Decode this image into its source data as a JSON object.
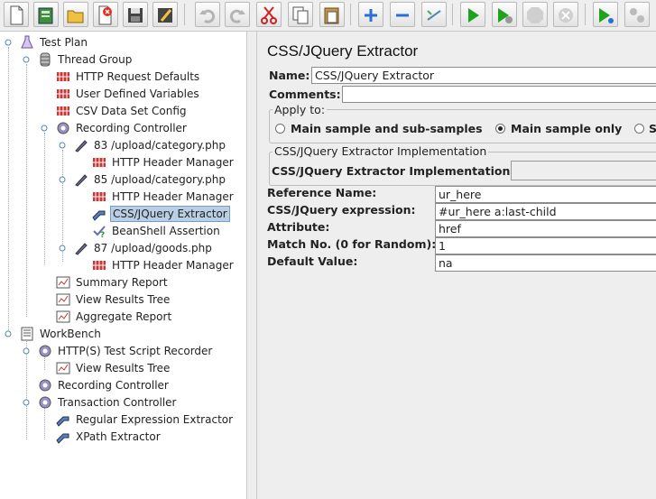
{
  "toolbar": {
    "buttons": [
      "new-icon",
      "templates-icon",
      "open-icon",
      "close-icon",
      "save-icon",
      "save-as-icon",
      "undo-icon",
      "redo-icon",
      "cut-icon",
      "copy-icon",
      "paste-icon",
      "expand-icon",
      "collapse-icon",
      "toggle-icon",
      "start-icon",
      "start-no-pauses-icon",
      "stop-icon",
      "shutdown-icon",
      "remote-start-icon",
      "remote-start-all-icon"
    ]
  },
  "tree": {
    "items": [
      {
        "label": "Test Plan",
        "icon": "test-plan-icon"
      },
      {
        "label": "Thread Group",
        "icon": "thread-group-icon"
      },
      {
        "label": "HTTP Request Defaults",
        "icon": "config-element-icon"
      },
      {
        "label": "User Defined Variables",
        "icon": "config-element-icon"
      },
      {
        "label": "CSV Data Set Config",
        "icon": "config-element-icon"
      },
      {
        "label": "Recording Controller",
        "icon": "controller-icon"
      },
      {
        "label": "83 /upload/category.php",
        "icon": "sampler-icon"
      },
      {
        "label": "HTTP Header Manager",
        "icon": "config-element-icon"
      },
      {
        "label": "85 /upload/category.php",
        "icon": "sampler-icon"
      },
      {
        "label": "HTTP Header Manager",
        "icon": "config-element-icon"
      },
      {
        "label": "CSS/JQuery Extractor",
        "icon": "extractor-icon"
      },
      {
        "label": "BeanShell Assertion",
        "icon": "assertion-icon"
      },
      {
        "label": "87 /upload/goods.php",
        "icon": "sampler-icon"
      },
      {
        "label": "HTTP Header Manager",
        "icon": "config-element-icon"
      },
      {
        "label": "Summary Report",
        "icon": "listener-icon"
      },
      {
        "label": "View Results Tree",
        "icon": "listener-icon"
      },
      {
        "label": "Aggregate Report",
        "icon": "listener-icon"
      },
      {
        "label": "WorkBench",
        "icon": "workbench-icon"
      },
      {
        "label": "HTTP(S) Test Script Recorder",
        "icon": "controller-icon"
      },
      {
        "label": "View Results Tree",
        "icon": "listener-icon"
      },
      {
        "label": "Recording Controller",
        "icon": "controller-icon"
      },
      {
        "label": "Transaction Controller",
        "icon": "controller-icon"
      },
      {
        "label": "Regular Expression Extractor",
        "icon": "extractor-icon"
      },
      {
        "label": "XPath Extractor",
        "icon": "extractor-icon"
      }
    ]
  },
  "panel": {
    "title": "CSS/JQuery Extractor",
    "name_label": "Name:",
    "name_value": "CSS/JQuery Extractor",
    "comments_label": "Comments:",
    "apply_to": {
      "title": "Apply to:",
      "options": [
        "Main sample and sub-samples",
        "Main sample only",
        "S"
      ],
      "selected": "Main sample only"
    },
    "impl": {
      "group_title": "CSS/JQuery Extractor Implementation",
      "label": "CSS/JQuery Extractor Implementation",
      "value": ""
    },
    "fields": [
      {
        "label": "Reference Name:",
        "value": "ur_here"
      },
      {
        "label": "CSS/JQuery expression:",
        "value": "#ur_here a:last-child"
      },
      {
        "label": "Attribute:",
        "value": "href"
      },
      {
        "label": "Match No. (0 for Random):",
        "value": "1"
      },
      {
        "label": "Default Value:",
        "value": "na"
      }
    ]
  }
}
